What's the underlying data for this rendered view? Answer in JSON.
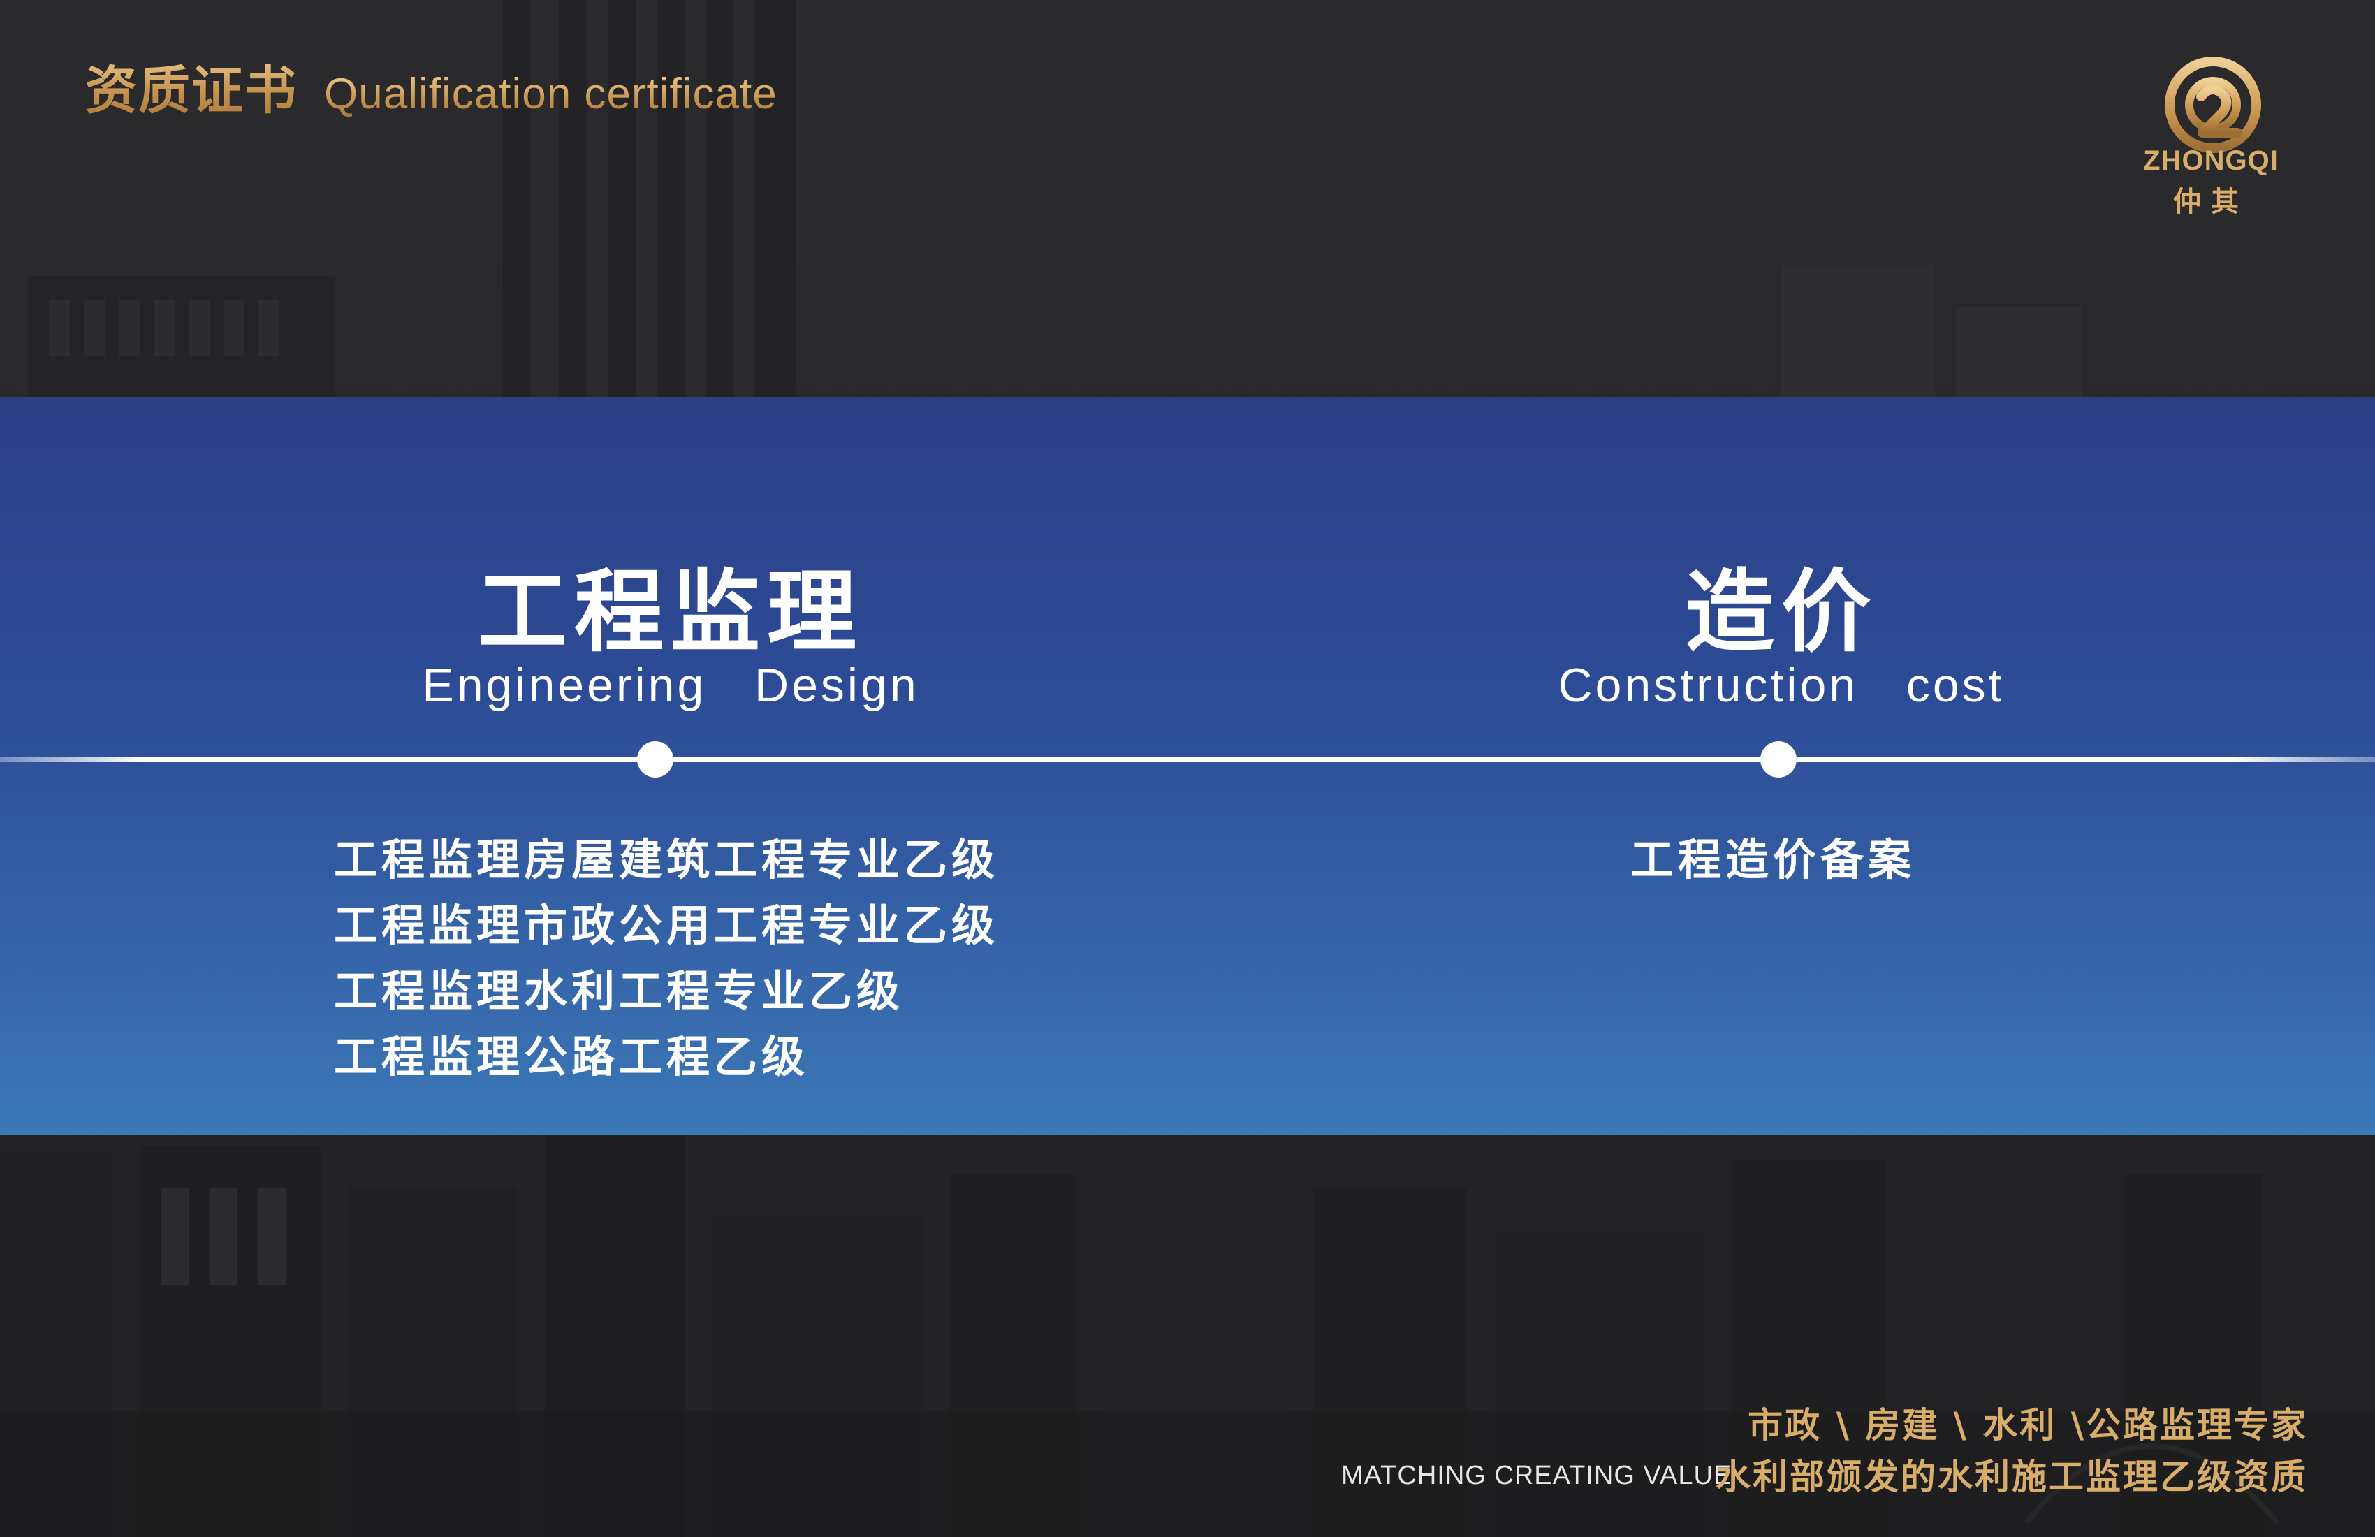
{
  "header": {
    "title_cn": "资质证书",
    "title_en": "Qualification certificate"
  },
  "logo": {
    "name_en": "ZHONGQI",
    "name_cn": "仲其"
  },
  "columns": [
    {
      "title": "工程监理",
      "subtitle": "Engineering   Design",
      "items": [
        "工程监理房屋建筑工程专业乙级",
        "工程监理市政公用工程专业乙级",
        "工程监理水利工程专业乙级",
        "工程监理公路工程乙级"
      ]
    },
    {
      "title": "造价",
      "subtitle": "Construction   cost",
      "items": [
        "工程造价备案"
      ]
    }
  ],
  "footer": {
    "tagline_1": "市政 \\ 房建 \\ 水利 \\公路监理专家",
    "tagline_2": "水利部颁发的水利施工监理乙级资质",
    "slogan": "MATCHING CREATING VALUE"
  },
  "colors": {
    "gold": "#d8ad6a",
    "band_top": "#2c3f86",
    "band_bottom": "#3b78b6",
    "background": "#2a2a2c"
  }
}
